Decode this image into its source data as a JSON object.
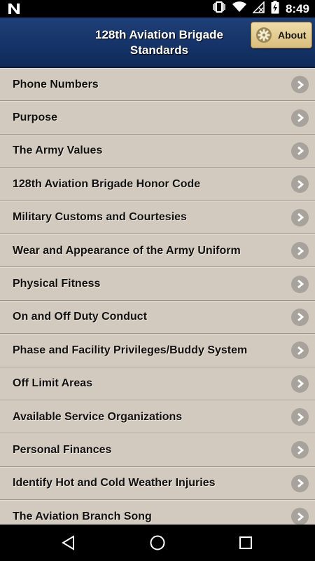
{
  "status_bar": {
    "time": "8:49",
    "icons": [
      "notification-n-icon",
      "vibrate-icon",
      "wifi-icon",
      "no-signal-icon",
      "battery-charging-icon"
    ]
  },
  "header": {
    "title": "128th Aviation Brigade Standards",
    "about_label": "About"
  },
  "menu": {
    "items": [
      {
        "label": "Phone Numbers"
      },
      {
        "label": "Purpose"
      },
      {
        "label": "The Army Values"
      },
      {
        "label": "128th Aviation Brigade Honor Code"
      },
      {
        "label": "Military Customs and Courtesies"
      },
      {
        "label": "Wear and Appearance of the Army Uniform"
      },
      {
        "label": "Physical Fitness"
      },
      {
        "label": "On and Off Duty Conduct"
      },
      {
        "label": "Phase and Facility Privileges/Buddy System"
      },
      {
        "label": "Off Limit Areas"
      },
      {
        "label": "Available Service Organizations"
      },
      {
        "label": "Personal Finances"
      },
      {
        "label": "Identify Hot and Cold Weather Injuries"
      },
      {
        "label": "The Aviation Branch Song"
      }
    ]
  },
  "colors": {
    "header_bg": "#15346a",
    "list_bg": "#d2c9bd",
    "about_button_bg": "#e6cf95"
  }
}
